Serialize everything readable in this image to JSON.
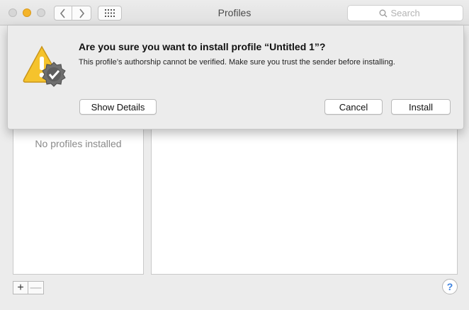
{
  "window": {
    "title": "Profiles"
  },
  "toolbar": {
    "back_icon": "chevron-left-icon",
    "forward_icon": "chevron-right-icon",
    "grid_icon": "grid-icon"
  },
  "search": {
    "placeholder": "Search",
    "icon": "search-icon"
  },
  "dialog": {
    "title": "Are you sure you want to install profile “Untitled 1”?",
    "message": "This profile’s authorship cannot be verified. Make sure you trust the sender before installing.",
    "icon": "warning-badge-icon",
    "buttons": {
      "details": "Show Details",
      "cancel": "Cancel",
      "install": "Install"
    }
  },
  "profiles_list": {
    "empty_text": "No profiles installed"
  },
  "footer": {
    "add_label": "+",
    "remove_label": "—",
    "help_label": "?"
  },
  "colors": {
    "minimize": "#f4b42a",
    "warning": "#f5c32c",
    "help": "#3d82e0"
  }
}
